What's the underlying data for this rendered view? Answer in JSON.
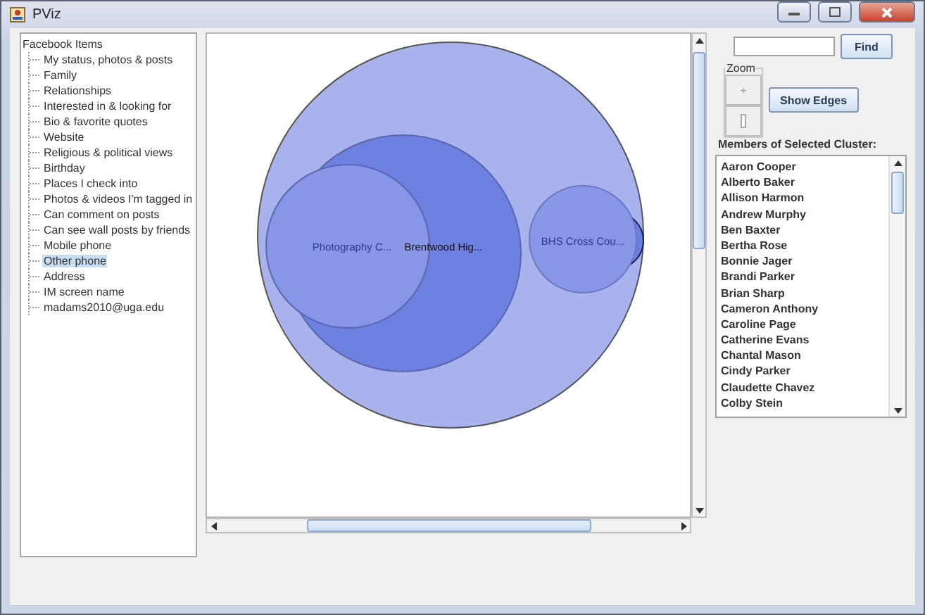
{
  "window": {
    "title": "PViz"
  },
  "tree": {
    "label": "Facebook Items",
    "children": [
      {
        "label": "My status, photos & posts",
        "selected": false
      },
      {
        "label": "Family",
        "selected": false
      },
      {
        "label": "Relationships",
        "selected": false
      },
      {
        "label": "Interested in & looking for",
        "selected": false
      },
      {
        "label": "Bio & favorite quotes",
        "selected": false
      },
      {
        "label": "Website",
        "selected": false
      },
      {
        "label": "Religious & political views",
        "selected": false
      },
      {
        "label": "Birthday",
        "selected": false
      },
      {
        "label": "Places I check into",
        "selected": false
      },
      {
        "label": "Photos & videos I'm tagged in",
        "selected": false
      },
      {
        "label": "Can comment on posts",
        "selected": false
      },
      {
        "label": "Can see wall posts by friends",
        "selected": false
      },
      {
        "label": "Mobile phone",
        "selected": false
      },
      {
        "label": "Other phone",
        "selected": true
      },
      {
        "label": "Address",
        "selected": false
      },
      {
        "label": "IM screen name",
        "selected": false
      },
      {
        "label": "madams2010@uga.edu",
        "selected": false
      }
    ]
  },
  "clusters": [
    {
      "label": "Photography C...",
      "selected": false
    },
    {
      "label": "Brentwood Hig...",
      "selected": true
    },
    {
      "label": "BHS Cross Cou...",
      "selected": false
    }
  ],
  "search": {
    "button": "Find"
  },
  "zoom": {
    "title": "Zoom",
    "zoom_in": "+"
  },
  "show_edges": "Show Edges",
  "members": {
    "title": "Members of Selected Cluster:",
    "items": [
      "Aaron Cooper",
      "Alberto Baker",
      "Allison Harmon",
      "Andrew Murphy",
      "Ben Baxter",
      "Bertha Rose",
      "Bonnie Jager",
      "Brandi Parker",
      "Brian Sharp",
      "Cameron Anthony",
      "Caroline Page",
      "Catherine Evans",
      "Chantal Mason",
      "Cindy Parker",
      "Claudette Chavez",
      "Colby Stein"
    ]
  }
}
